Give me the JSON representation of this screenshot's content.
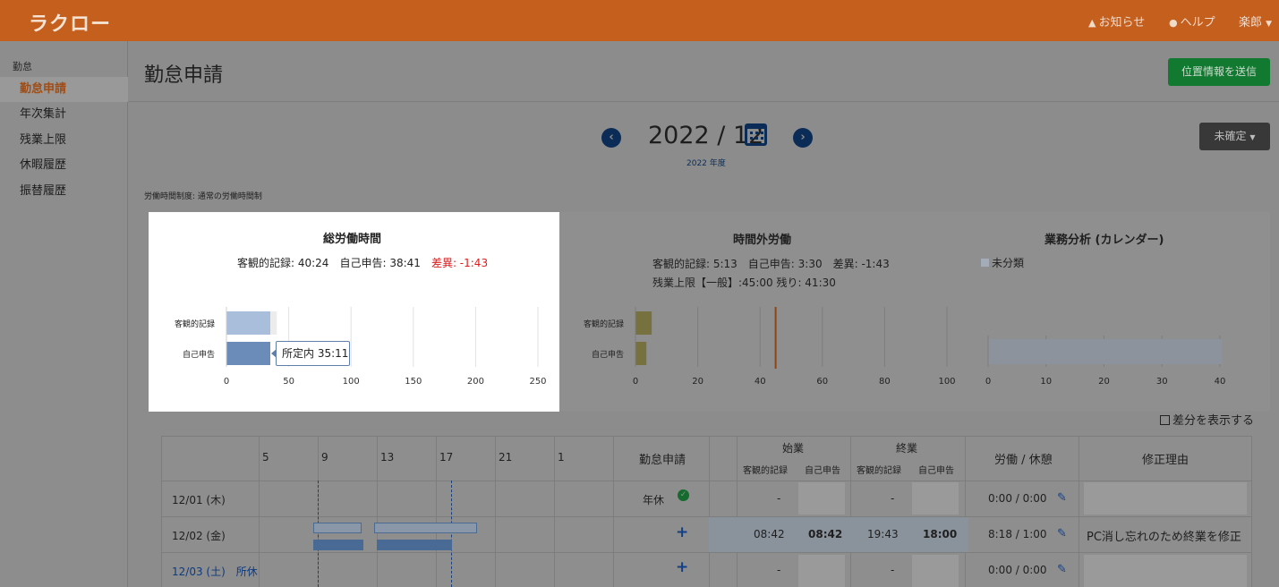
{
  "header": {
    "logo": "ラクロー",
    "notice": "お知らせ",
    "help": "ヘルプ",
    "user": "楽郎"
  },
  "sidebar": {
    "section": "勤怠",
    "items": [
      {
        "label": "勤怠申請",
        "active": true
      },
      {
        "label": "年次集計",
        "active": false
      },
      {
        "label": "残業上限",
        "active": false
      },
      {
        "label": "休暇履歴",
        "active": false
      },
      {
        "label": "振替履歴",
        "active": false
      }
    ]
  },
  "page": {
    "title": "勤怠申請",
    "send_location": "位置情報を送信",
    "status_dropdown": "未確定",
    "month": "2022 / 12",
    "fiscal_year": "2022 年度",
    "system": "労働時間制度: 通常の労働時間制"
  },
  "panels": {
    "total": {
      "title": "総労働時間",
      "objective": "客観的記録: 40:24",
      "self": "自己申告: 38:41",
      "diff": "差異: -1:43",
      "tooltip": "所定内 35:11"
    },
    "overtime": {
      "title": "時間外労働",
      "line1": "客観的記録: 5:13　自己申告: 3:30　差異: -1:43",
      "line2": "残業上限【一般】:45:00 残り: 41:30"
    },
    "analysis": {
      "title": "業務分析 (カレンダー)",
      "legend": "未分類"
    }
  },
  "chart_data": [
    {
      "type": "bar",
      "orientation": "horizontal",
      "categories": [
        "客観的記録",
        "自己申告"
      ],
      "series": [
        {
          "name": "所定内",
          "values": [
            35.2,
            35.2
          ]
        },
        {
          "values": [
            5.2,
            3.5
          ]
        }
      ],
      "xlim": [
        0,
        250
      ],
      "xticks": [
        0,
        50,
        100,
        150,
        200,
        250
      ]
    },
    {
      "type": "bar",
      "orientation": "horizontal",
      "categories": [
        "客観的記録",
        "自己申告"
      ],
      "values": [
        5.2,
        3.5
      ],
      "xlim": [
        0,
        100
      ],
      "xticks": [
        0,
        20,
        40,
        60,
        80,
        100
      ],
      "limit_line": 45
    },
    {
      "type": "bar",
      "orientation": "horizontal",
      "categories": [
        ""
      ],
      "series": [
        {
          "name": "未分類",
          "values": [
            40.4
          ]
        }
      ],
      "xlim": [
        0,
        40
      ],
      "xticks": [
        0,
        10,
        20,
        30,
        40
      ]
    }
  ],
  "diff_toggle": "差分を表示する",
  "table": {
    "hours": [
      "5",
      "9",
      "13",
      "17",
      "21",
      "1"
    ],
    "col_request": "勤怠申請",
    "col_start": "始業",
    "col_end": "終業",
    "sub_obj": "客観的記録",
    "sub_self": "自己申告",
    "col_work": "労働 / 休憩",
    "col_reason": "修正理由",
    "rows": [
      {
        "date": "12/01 (木)",
        "request": "年休",
        "start_obj": "-",
        "start_self": "",
        "end_obj": "-",
        "end_self": "",
        "work": "0:00 / 0:00",
        "reason": ""
      },
      {
        "date": "12/02 (金)",
        "request": "+",
        "start_obj": "08:42",
        "start_self": "08:42",
        "end_obj": "19:43",
        "end_self": "18:00",
        "work": "8:18 / 1:00",
        "reason": "PC消し忘れのため終業を修正"
      },
      {
        "date": "12/03 (土)",
        "holiday": "所休",
        "request": "+",
        "start_obj": "-",
        "start_self": "",
        "end_obj": "-",
        "end_self": "",
        "work": "0:00 / 0:00",
        "reason": ""
      }
    ]
  }
}
